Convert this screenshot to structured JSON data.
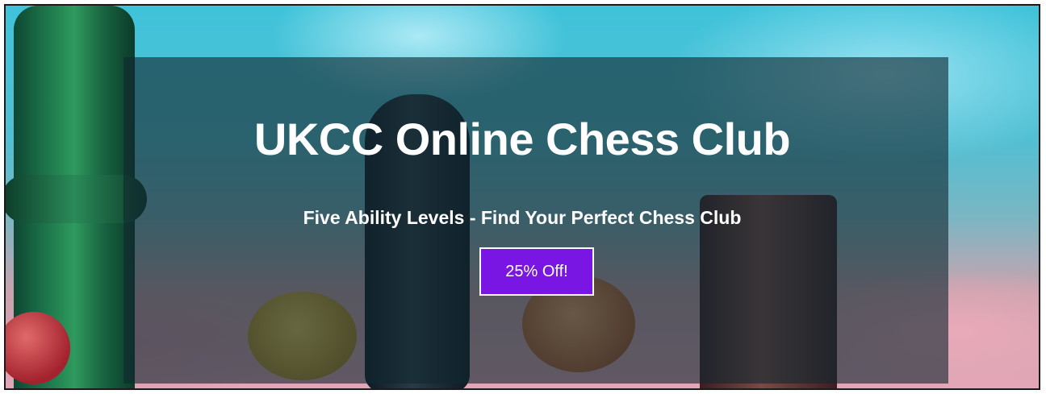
{
  "hero": {
    "title": "UKCC Online Chess Club",
    "subtitle": "Five Ability Levels - Find Your Perfect Chess Club",
    "cta_label": "25% Off!",
    "colors": {
      "cta_background": "#7a16e3",
      "overlay": "#122830",
      "text": "#ffffff"
    }
  }
}
